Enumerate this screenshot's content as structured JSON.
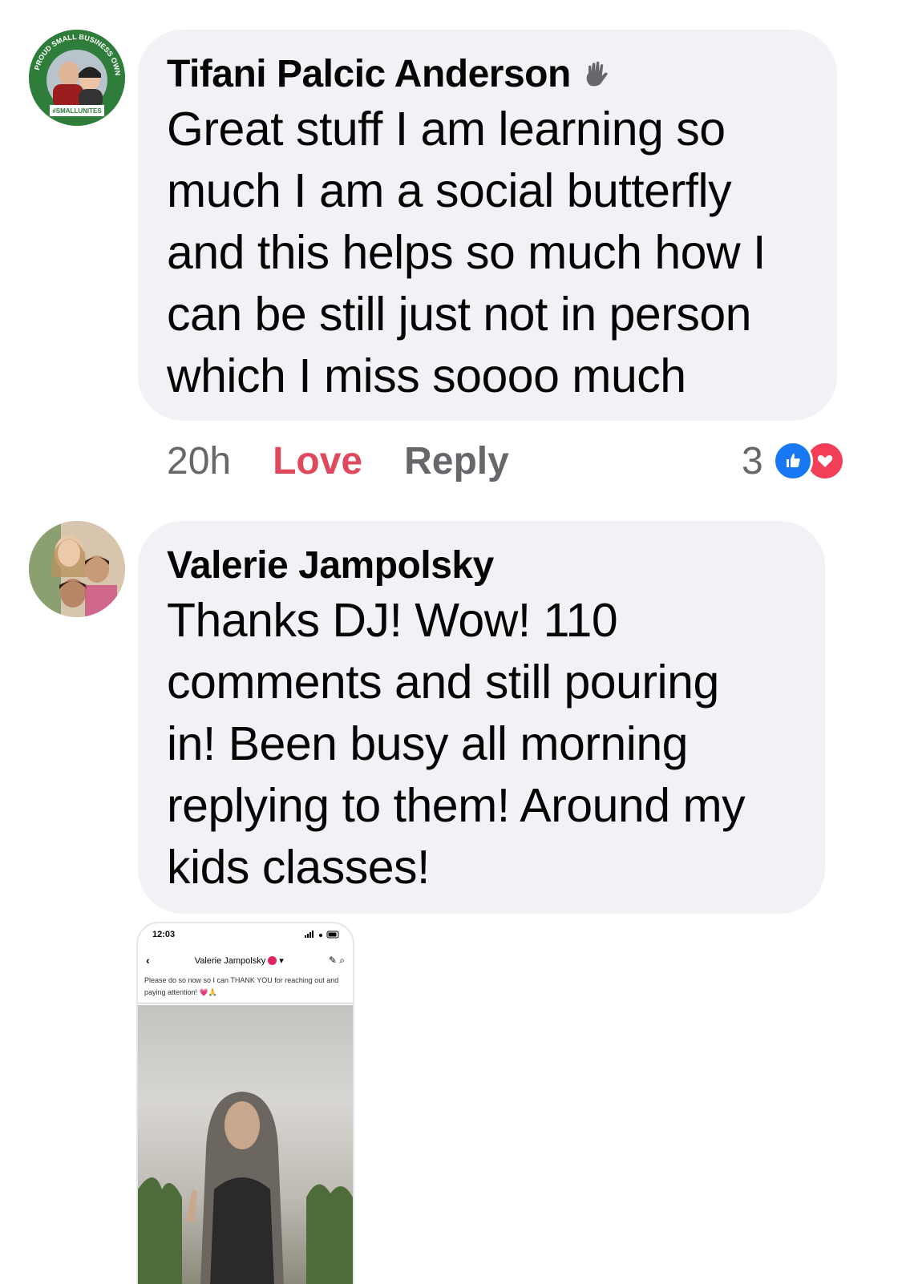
{
  "comments": [
    {
      "author": "Tifani Palcic Anderson",
      "text": "Great stuff I am learning so\nmuch  I am a social butterfly\nand this helps so much how I\ncan be still just not in person\nwhich I miss soooo much",
      "avatar_badge": [
        "PROUD SMALL BUSINESS OWNER",
        "#SMALLUNITES"
      ],
      "time": "20h",
      "love_label": "Love",
      "reply_label": "Reply",
      "reaction_count": "3",
      "reaction_icons": [
        "like-icon",
        "heart-icon"
      ],
      "colors": {
        "love": "#e0485d",
        "like": "#1877f2",
        "heart": "#f33e58"
      }
    },
    {
      "author": "Valerie Jampolsky",
      "text": "Thanks DJ! Wow! 110\ncomments and still pouring\nin! Been busy all morning\nreplying to them! Around my\nkids classes!"
    }
  ],
  "attachment": {
    "status_time": "12:03",
    "header_name": "Valerie Jampolsky",
    "message": "Please do so now so I can THANK YOU for reaching out and paying attention! 💗🙏"
  }
}
